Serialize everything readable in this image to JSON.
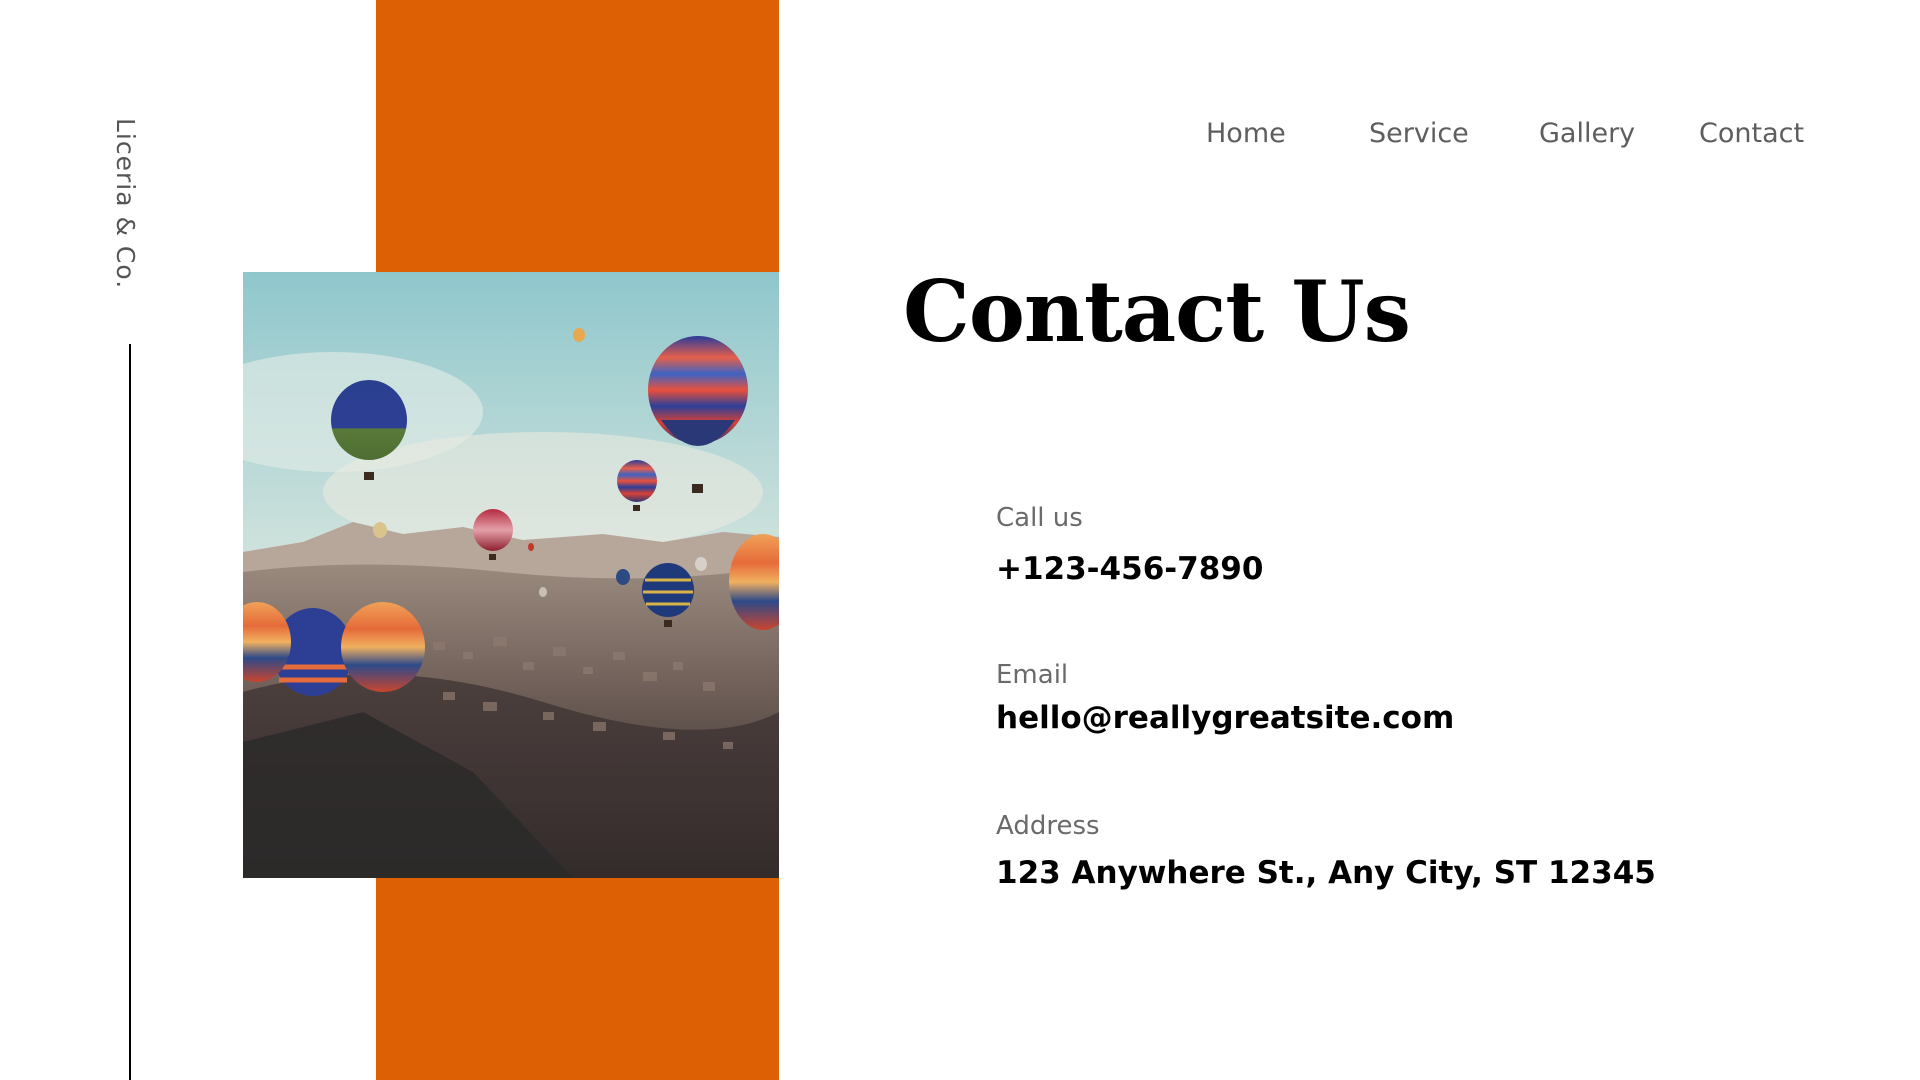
{
  "brand": {
    "name": "Liceria & Co."
  },
  "nav": {
    "items": [
      {
        "label": "Home"
      },
      {
        "label": "Service"
      },
      {
        "label": "Gallery"
      },
      {
        "label": "Contact"
      }
    ]
  },
  "page": {
    "title": "Contact Us"
  },
  "contact": {
    "phone": {
      "label": "Call us",
      "value": "+123-456-7890"
    },
    "email": {
      "label": "Email",
      "value": "hello@reallygreatsite.com"
    },
    "address": {
      "label": "Address",
      "value": "123 Anywhere St., Any City, ST 12345"
    }
  },
  "colors": {
    "accent": "#dd6104",
    "background": "#ffffff",
    "text": "#000000",
    "muted": "#6a6a6a"
  },
  "image": {
    "alt": "hot-air-balloons-photo"
  }
}
